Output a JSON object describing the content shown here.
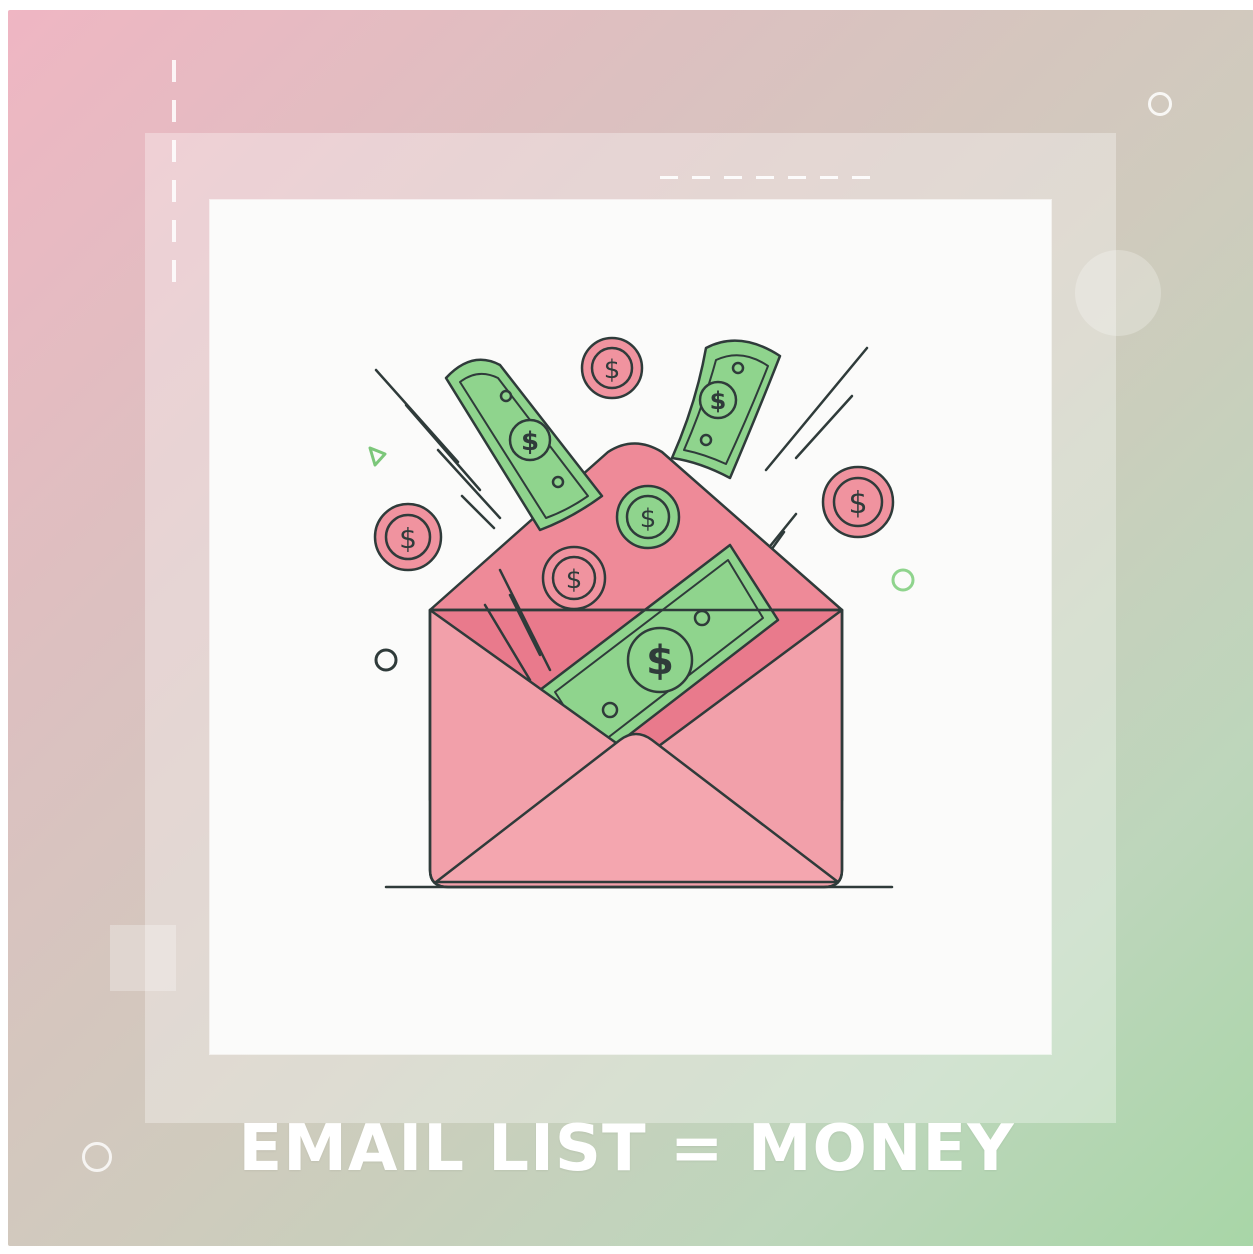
{
  "headline": {
    "text": "EMAIL LIST = MONEY"
  },
  "colors": {
    "background_gradient_start": "#efb6c3",
    "background_gradient_end": "#a8d6a7",
    "envelope_pink": "#f2a0aa",
    "envelope_inner": "#e97a8c",
    "envelope_flap": "#ee8a98",
    "money_green": "#8fd48d",
    "coin_pink": "#f0939f",
    "outline": "#2f3b3a",
    "panel": "#fbfbfa",
    "headline": "#ffffff"
  },
  "icons": {
    "envelope": "envelope-icon",
    "banknote": "banknote-icon",
    "coin": "dollar-coin-icon"
  },
  "coins": {
    "symbol": "$"
  }
}
